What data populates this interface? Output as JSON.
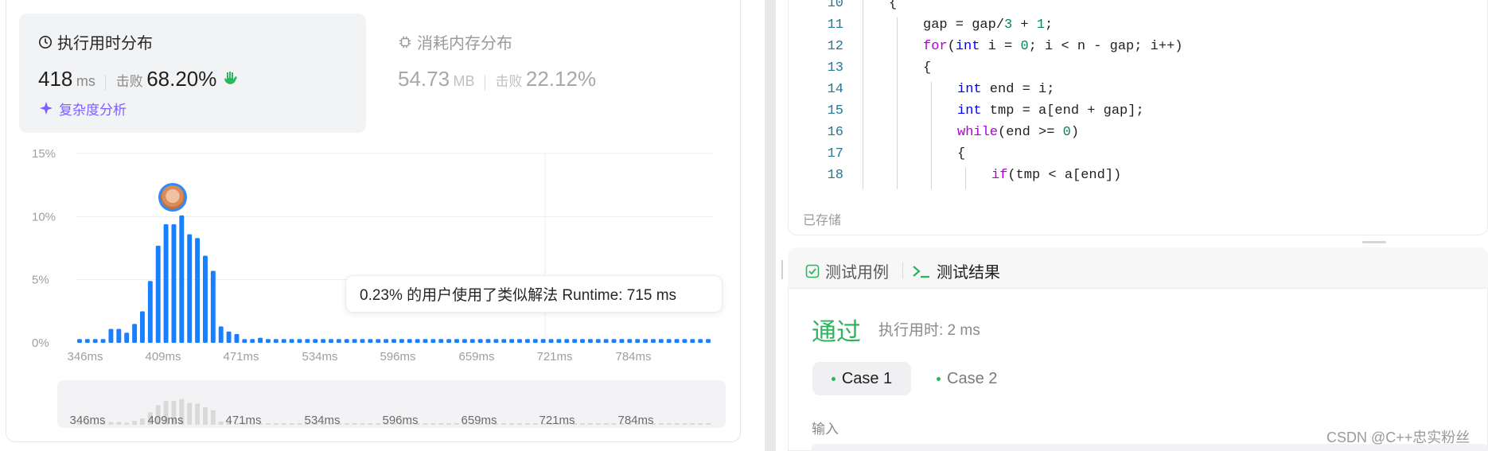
{
  "runtime": {
    "title": "执行用时分布",
    "value": "418",
    "unit": "ms",
    "beat_label": "击败",
    "beat_value": "68.20%",
    "complexity_link": "复杂度分析"
  },
  "memory": {
    "title": "消耗内存分布",
    "value": "54.73",
    "unit": "MB",
    "beat_label": "击败",
    "beat_value": "22.12%"
  },
  "tooltip": "0.23% 的用户使用了类似解法 Runtime: 715 ms",
  "chart_data": {
    "type": "bar",
    "title": "",
    "xlabel": "",
    "ylabel": "",
    "y_ticks": [
      "15%",
      "10%",
      "5%",
      "0%"
    ],
    "ylim": [
      0,
      15
    ],
    "x_tick_labels": [
      "346ms",
      "409ms",
      "471ms",
      "534ms",
      "596ms",
      "659ms",
      "721ms",
      "784ms"
    ],
    "grid": true,
    "values": [
      0.3,
      0.3,
      0.3,
      0.3,
      1.1,
      1.1,
      0.8,
      1.5,
      2.5,
      4.9,
      7.7,
      9.4,
      9.4,
      10.1,
      8.6,
      8.3,
      6.9,
      5.7,
      1.3,
      0.9,
      0.7,
      0.3,
      0.3,
      0.4,
      0.3,
      0.3,
      0.3,
      0.3,
      0.3,
      0.3,
      0.3,
      0.3,
      0.3,
      0.3,
      0.3,
      0.3,
      0.3,
      0.3,
      0.3,
      0.3,
      0.3,
      0.3,
      0.3,
      0.3,
      0.3,
      0.3,
      0.3,
      0.3,
      0.3,
      0.3,
      0.3,
      0.3,
      0.3,
      0.3,
      0.3,
      0.3,
      0.3,
      0.3,
      0.3,
      0.3,
      0.3,
      0.3,
      0.3,
      0.3,
      0.3,
      0.3,
      0.3,
      0.3,
      0.3,
      0.3,
      0.3,
      0.3,
      0.3,
      0.3,
      0.3,
      0.3,
      0.3,
      0.3,
      0.3,
      0.3,
      0.3
    ],
    "color": "#1a7fff",
    "mini_color": "#d9d9d9"
  },
  "editor": {
    "lines": [
      {
        "n": "10",
        "indent": 1,
        "tokens": [
          {
            "t": "{",
            "c": ""
          }
        ]
      },
      {
        "n": "11",
        "indent": 2,
        "tokens": [
          {
            "t": "gap = gap/",
            "c": ""
          },
          {
            "t": "3",
            "c": "num"
          },
          {
            "t": " + ",
            "c": ""
          },
          {
            "t": "1",
            "c": "num"
          },
          {
            "t": ";",
            "c": ""
          }
        ]
      },
      {
        "n": "12",
        "indent": 2,
        "tokens": [
          {
            "t": "for",
            "c": "ctl"
          },
          {
            "t": "(",
            "c": ""
          },
          {
            "t": "int",
            "c": "kw"
          },
          {
            "t": " i = ",
            "c": ""
          },
          {
            "t": "0",
            "c": "num"
          },
          {
            "t": "; i < n - gap; i++)",
            "c": ""
          }
        ]
      },
      {
        "n": "13",
        "indent": 2,
        "tokens": [
          {
            "t": "{",
            "c": ""
          }
        ]
      },
      {
        "n": "14",
        "indent": 3,
        "tokens": [
          {
            "t": "int",
            "c": "kw"
          },
          {
            "t": " end = i;",
            "c": ""
          }
        ]
      },
      {
        "n": "15",
        "indent": 3,
        "tokens": [
          {
            "t": "int",
            "c": "kw"
          },
          {
            "t": " tmp = a[end + gap];",
            "c": ""
          }
        ]
      },
      {
        "n": "16",
        "indent": 3,
        "tokens": [
          {
            "t": "while",
            "c": "ctl"
          },
          {
            "t": "(end >= ",
            "c": ""
          },
          {
            "t": "0",
            "c": "num"
          },
          {
            "t": ")",
            "c": ""
          }
        ]
      },
      {
        "n": "17",
        "indent": 3,
        "tokens": [
          {
            "t": "{",
            "c": ""
          }
        ]
      },
      {
        "n": "18",
        "indent": 4,
        "tokens": [
          {
            "t": "if",
            "c": "ctl"
          },
          {
            "t": "(tmp < a[end])",
            "c": ""
          }
        ]
      }
    ],
    "saved": "已存储"
  },
  "tests": {
    "tab_cases": "测试用例",
    "tab_results": "测试结果",
    "status": "通过",
    "exec_time": "执行用时: 2 ms",
    "case1": "Case 1",
    "case2": "Case 2",
    "input_label": "输入"
  },
  "watermark": "CSDN @C++忠实粉丝"
}
